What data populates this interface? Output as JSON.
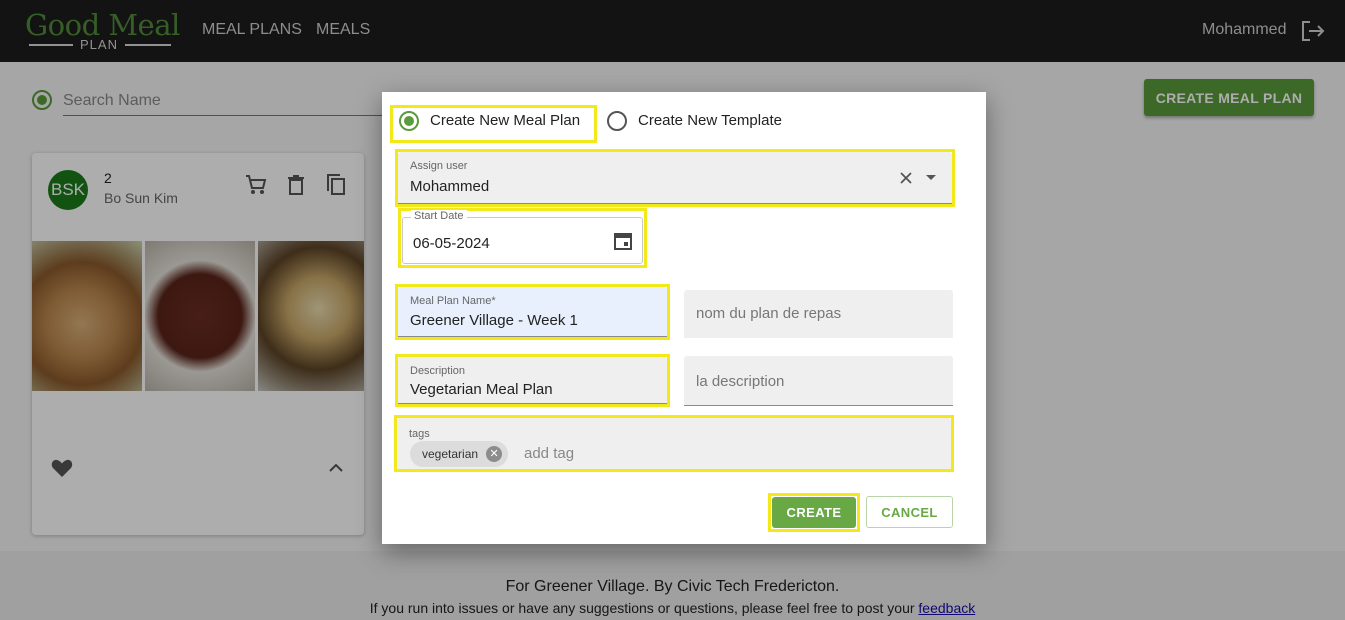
{
  "header": {
    "logo_main": "Good Meal",
    "logo_sub": "PLAN",
    "nav": [
      "MEAL PLANS",
      "MEALS"
    ],
    "user": "Mohammed",
    "logout_icon": "logout-icon"
  },
  "toolbar": {
    "search_placeholder": "Search Name",
    "create_button": "CREATE MEAL PLAN"
  },
  "card": {
    "initials": "BSK",
    "title": "2",
    "owner": "Bo Sun Kim",
    "icons": [
      "cart-icon",
      "delete-icon",
      "copy-icon",
      "heart-icon",
      "chevron-up-icon"
    ]
  },
  "footer": {
    "line1": "For Greener Village. By Civic Tech Fredericton.",
    "line2": "If you run into issues or have any suggestions or questions, please feel free to post your",
    "link": "feedback"
  },
  "dialog": {
    "options": [
      "Create New Meal Plan",
      "Create New Template"
    ],
    "selected_option": "Create New Meal Plan",
    "assign_user": {
      "label": "Assign user",
      "value": "Mohammed"
    },
    "start_date": {
      "label": "Start Date",
      "value": "06-05-2024"
    },
    "plan_name": {
      "label": "Meal Plan Name*",
      "value": "Greener Village - Week 1",
      "fr_placeholder": "nom du plan de repas"
    },
    "description": {
      "label": "Description",
      "value": "Vegetarian Meal Plan",
      "fr_placeholder": "la description"
    },
    "tags": {
      "label": "tags",
      "chips": [
        "vegetarian"
      ],
      "placeholder": "add tag"
    },
    "create_label": "CREATE",
    "cancel_label": "CANCEL",
    "highlight_color": "#f2e81a",
    "accent_color": "#68a845"
  }
}
